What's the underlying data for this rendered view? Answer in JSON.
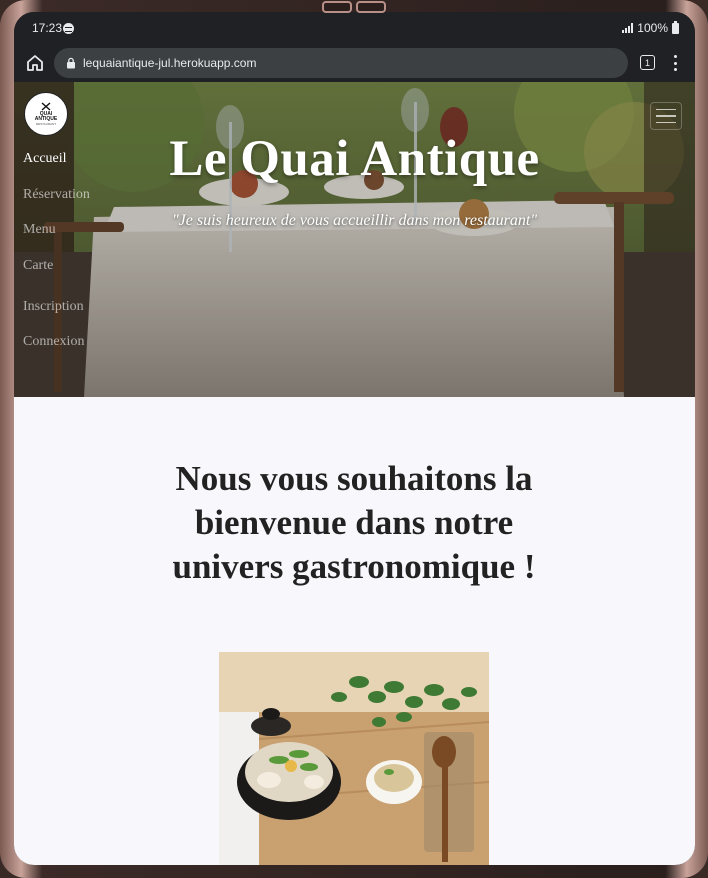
{
  "status_bar": {
    "time": "17:23",
    "battery": "100%"
  },
  "browser": {
    "url": "lequaiantique-jul.herokuapp.com",
    "tab_count": "1"
  },
  "site": {
    "logo": {
      "line1": "QUAI",
      "line2": "ANTIQUE",
      "line3": "RESTAURANT"
    },
    "nav": [
      {
        "label": "Accueil",
        "active": true
      },
      {
        "label": "Réservation",
        "active": false
      },
      {
        "label": "Menu",
        "active": false
      },
      {
        "label": "Carte",
        "active": false
      },
      {
        "label": "Inscription",
        "active": false
      },
      {
        "label": "Connexion",
        "active": false
      }
    ],
    "hero": {
      "title": "Le Quai Antique",
      "quote": "\"Je suis heureux de vous accueillir dans mon restaurant\""
    },
    "welcome": "Nous vous souhaitons la bienvenue dans notre univers gastronomique !"
  },
  "colors": {
    "page_bg": "#f8f7fc",
    "browser_bar": "#202124",
    "url_box": "#3c4043"
  }
}
